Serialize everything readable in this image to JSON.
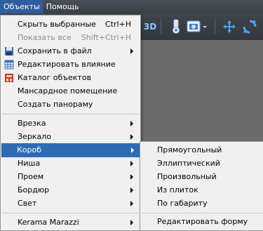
{
  "menubar": {
    "objects": "Объекты",
    "help": "Помощь"
  },
  "toolbar": {
    "label_3d": "3D"
  },
  "main_menu": {
    "hide_selected": "Скрыть выбранные",
    "hide_selected_shortcut": "Ctrl+H",
    "show_all": "Показать все",
    "show_all_shortcut": "Shift+Ctrl+H",
    "save_to_file": "Сохранить в файл",
    "edit_influence": "Редактировать влияние",
    "object_catalog": "Каталог объектов",
    "attic_room": "Мансардное помещение",
    "create_panorama": "Создать панораму",
    "insert": "Врезка",
    "mirror": "Зеркало",
    "box": "Короб",
    "niche": "Ниша",
    "opening": "Проем",
    "border": "Бордюр",
    "light": "Свет",
    "kerama_marazzi": "Kerama Marazzi"
  },
  "box_submenu": {
    "rectangular": "Прямоугольный",
    "elliptical": "Эллиптический",
    "arbitrary": "Произвольный",
    "from_tiles": "Из плиток",
    "by_dimensions": "По габариту",
    "edit_shape": "Редактировать форму"
  },
  "colors": {
    "highlight": "#2d6bb5",
    "menu_bg": "#f0f0f0",
    "toolbar_bg": "#3b4047",
    "viewport_bg": "#6b6b6b"
  },
  "icons": [
    "save-icon",
    "table-icon",
    "catalog-icon",
    "camera-icon",
    "move-icon",
    "rotate-icon",
    "paint-icon"
  ]
}
